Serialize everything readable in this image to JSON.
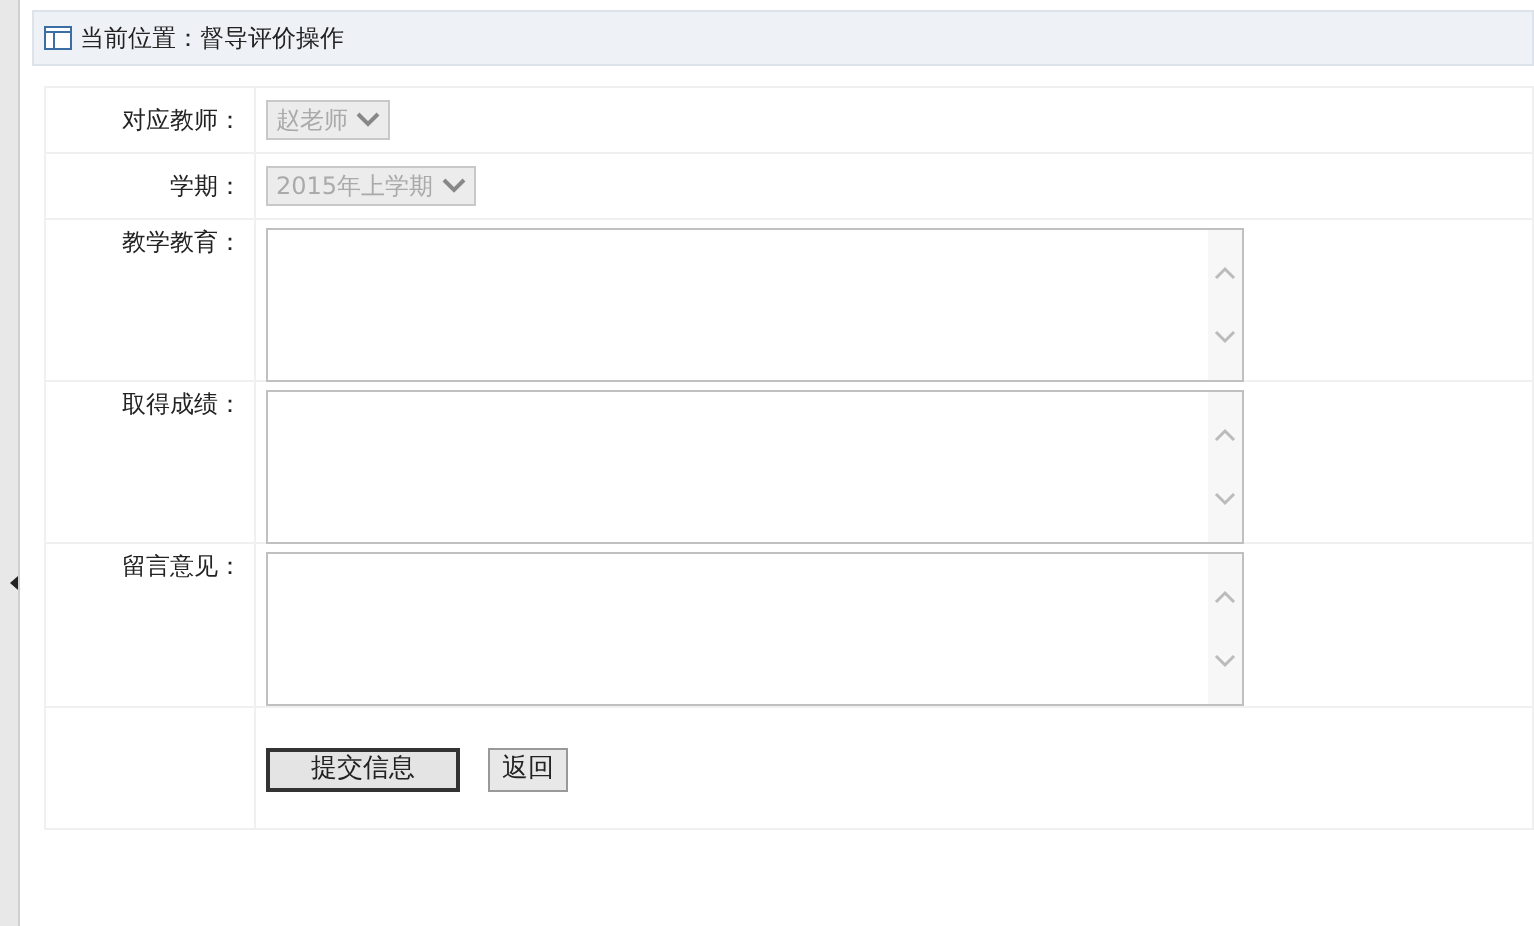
{
  "breadcrumb": "当前位置：督导评价操作",
  "fields": [
    {
      "kind": "select",
      "label": "对应教师：",
      "value": "赵老师",
      "disabled": true
    },
    {
      "kind": "select",
      "label": "学期：",
      "value": "2015年上学期",
      "disabled": true
    },
    {
      "kind": "textarea",
      "label": "教学教育："
    },
    {
      "kind": "textarea",
      "label": "取得成绩："
    },
    {
      "kind": "textarea",
      "label": "留言意见："
    }
  ],
  "buttons": [
    {
      "kind": "primary",
      "label": "提交信息"
    },
    {
      "kind": "plain",
      "label": "返回"
    }
  ]
}
